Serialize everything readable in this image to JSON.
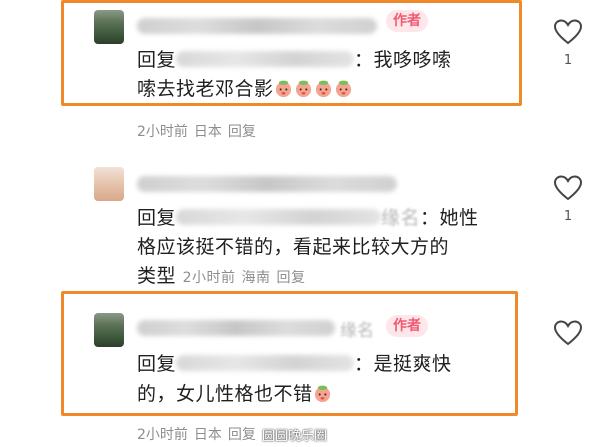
{
  "comments": [
    {
      "badge": "作者",
      "reply_prefix": "回复",
      "text_line1": "：我哆哆嗦",
      "text_line2": "嗦去找老邓合影",
      "time": "2小时前",
      "location": "日本",
      "reply": "回复",
      "like_count": "1"
    },
    {
      "reply_prefix": "回复",
      "mention_tail": "缘名",
      "text_line1": "：她性",
      "text_line2": "格应该挺不错的，看起来比较大方的",
      "text_line3": "类型",
      "time": "2小时前",
      "location": "海南",
      "reply": "回复",
      "like_count": "1"
    },
    {
      "badge": "作者",
      "name_tail": "缘名",
      "reply_prefix": "回复",
      "text_line1": "：是挺爽快",
      "text_line2": "的，女儿性格也不错",
      "time": "2小时前",
      "location": "日本",
      "reply": "回复"
    }
  ],
  "watermark": "圆圆晚乐圈",
  "colors": {
    "highlight": "#ef8a2a",
    "badge_text": "#f25a73",
    "badge_bg": "#fde7ea",
    "meta": "#8e8e8e"
  },
  "icons": [
    "heart-outline-icon",
    "peach-emoji-icon"
  ]
}
